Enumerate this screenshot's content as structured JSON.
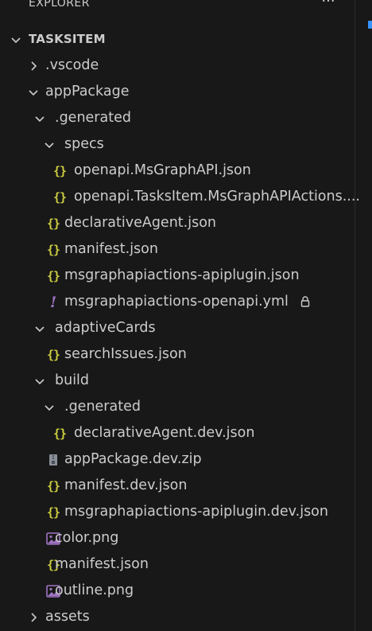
{
  "header": {
    "title": "EXPLORER",
    "more_label": "···"
  },
  "section": {
    "label": "TASKSITEM"
  },
  "tree": [
    {
      "label": ".vscode",
      "type": "folder",
      "expanded": false,
      "depth": 0
    },
    {
      "label": "appPackage",
      "type": "folder",
      "expanded": true,
      "depth": 0
    },
    {
      "label": ".generated",
      "type": "folder",
      "expanded": true,
      "depth": 1
    },
    {
      "label": "specs",
      "type": "folder",
      "expanded": true,
      "depth": 2
    },
    {
      "label": "openapi.MsGraphAPI.json",
      "type": "json",
      "depth": 3
    },
    {
      "label": "openapi.TasksItem.MsGraphAPIActions....",
      "type": "json",
      "depth": 3
    },
    {
      "label": "declarativeAgent.json",
      "type": "json",
      "depth": 2
    },
    {
      "label": "manifest.json",
      "type": "json",
      "depth": 2
    },
    {
      "label": "msgraphapiactions-apiplugin.json",
      "type": "json",
      "depth": 2
    },
    {
      "label": "msgraphapiactions-openapi.yml",
      "type": "yml",
      "depth": 2,
      "locked": true
    },
    {
      "label": "adaptiveCards",
      "type": "folder",
      "expanded": true,
      "depth": 1
    },
    {
      "label": "searchIssues.json",
      "type": "json",
      "depth": 2
    },
    {
      "label": "build",
      "type": "folder",
      "expanded": true,
      "depth": 1
    },
    {
      "label": ".generated",
      "type": "folder",
      "expanded": true,
      "depth": 2
    },
    {
      "label": "declarativeAgent.dev.json",
      "type": "json",
      "depth": 3
    },
    {
      "label": "appPackage.dev.zip",
      "type": "zip",
      "depth": 2
    },
    {
      "label": "manifest.dev.json",
      "type": "json",
      "depth": 2
    },
    {
      "label": "msgraphapiactions-apiplugin.dev.json",
      "type": "json",
      "depth": 2
    },
    {
      "label": "color.png",
      "type": "image",
      "depth": 1
    },
    {
      "label": "manifest.json",
      "type": "json",
      "depth": 1
    },
    {
      "label": "outline.png",
      "type": "image",
      "depth": 1
    },
    {
      "label": "assets",
      "type": "folder",
      "expanded": false,
      "depth": 0
    }
  ],
  "icons": {
    "json": "braces-icon",
    "yml": "exclamation-icon",
    "zip": "zip-file-icon",
    "image": "image-file-icon",
    "lock": "lock-icon"
  },
  "colors": {
    "background": "#181818",
    "text": "#cccccc",
    "json_icon": "#cbcb41",
    "yml_icon": "#a074c4",
    "image_icon": "#a074c4",
    "accent": "#3794ff"
  }
}
